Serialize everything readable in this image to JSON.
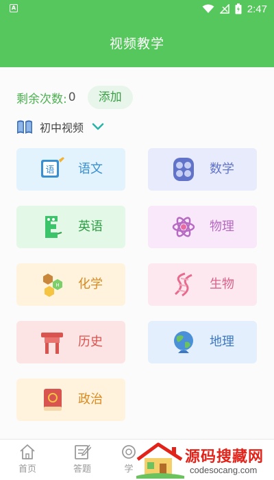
{
  "status_bar": {
    "time": "2:47"
  },
  "header": {
    "title": "视频教学"
  },
  "remaining": {
    "label": "剩余次数:",
    "count": "0",
    "add_label": "添加"
  },
  "category": {
    "label": "初中视频"
  },
  "subjects": [
    {
      "name": "语文",
      "bg": "#e3f3fd",
      "text": "#3a8fd0"
    },
    {
      "name": "数学",
      "bg": "#e8ebfb",
      "text": "#6173c8"
    },
    {
      "name": "英语",
      "bg": "#e3f8e6",
      "text": "#2f9f47"
    },
    {
      "name": "物理",
      "bg": "#f8e8f9",
      "text": "#b66ac2"
    },
    {
      "name": "化学",
      "bg": "#fff3de",
      "text": "#d98a1e"
    },
    {
      "name": "生物",
      "bg": "#fde8ef",
      "text": "#d8628c"
    },
    {
      "name": "历史",
      "bg": "#fde4e4",
      "text": "#d9534f"
    },
    {
      "name": "地理",
      "bg": "#e3effc",
      "text": "#3d78c4"
    },
    {
      "name": "政治",
      "bg": "#fff3de",
      "text": "#d98a1e"
    }
  ],
  "bottom_nav": [
    {
      "label": "首页"
    },
    {
      "label": "答题"
    },
    {
      "label": "学"
    }
  ],
  "watermark": {
    "title": "源码搜藏网",
    "url": "codesocang.com"
  },
  "colors": {
    "primary": "#56c75c",
    "accent_text": "#4caf50"
  }
}
